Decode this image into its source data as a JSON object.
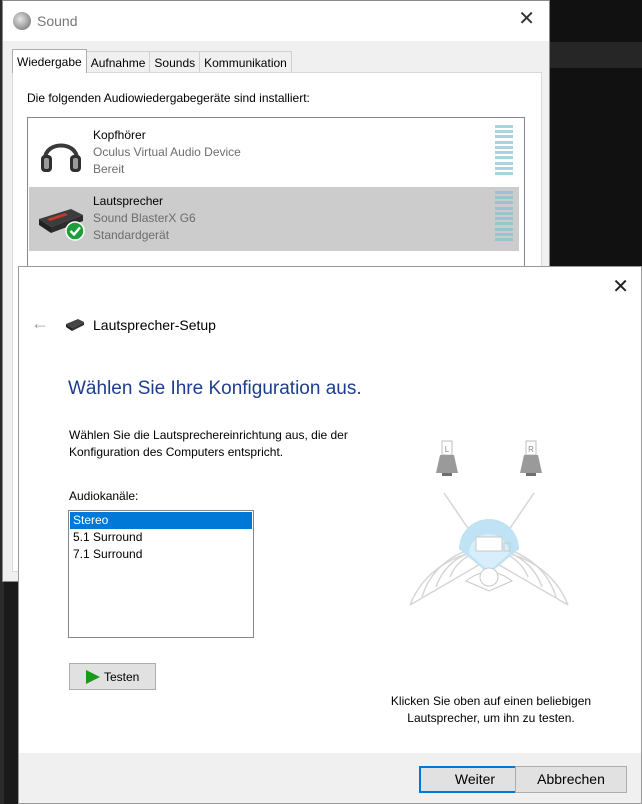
{
  "sound_window": {
    "title": "Sound",
    "close_glyph": "✕",
    "tabs": [
      {
        "label": "Wiedergabe",
        "active": true
      },
      {
        "label": "Aufnahme",
        "active": false
      },
      {
        "label": "Sounds",
        "active": false
      },
      {
        "label": "Kommunikation",
        "active": false
      }
    ],
    "intro": "Die folgenden Audiowiedergabegeräte sind installiert:",
    "devices": [
      {
        "name": "Kopfhörer",
        "description": "Oculus Virtual Audio Device",
        "state": "Bereit",
        "icon": "headphones-icon",
        "selected": false
      },
      {
        "name": "Lautsprecher",
        "description": "Sound BlasterX G6",
        "state": "Standardgerät",
        "icon": "sound-card-icon",
        "selected": true,
        "default_badge": "check-icon"
      }
    ]
  },
  "setup_window": {
    "close_glyph": "✕",
    "back_glyph": "←",
    "title": "Lautsprecher-Setup",
    "heading": "Wählen Sie Ihre Konfiguration aus.",
    "description": "Wählen Sie die Lautsprechereinrichtung aus, die der Konfiguration des Computers entspricht.",
    "channels_label": "Audiokanäle:",
    "channels": [
      {
        "label": "Stereo",
        "selected": true
      },
      {
        "label": "5.1 Surround",
        "selected": false
      },
      {
        "label": "7.1 Surround",
        "selected": false
      }
    ],
    "test_button": "Testen",
    "speaker_labels": {
      "left": "L",
      "right": "R"
    },
    "hint": "Klicken Sie oben auf einen beliebigen Lautsprecher, um ihn zu testen.",
    "next_button": "Weiter",
    "cancel_button": "Abbrechen"
  },
  "colors": {
    "accent": "#0078d7",
    "heading": "#1e3d8f",
    "selection_gray": "#cccccc",
    "play_green": "#1a9a1a"
  }
}
